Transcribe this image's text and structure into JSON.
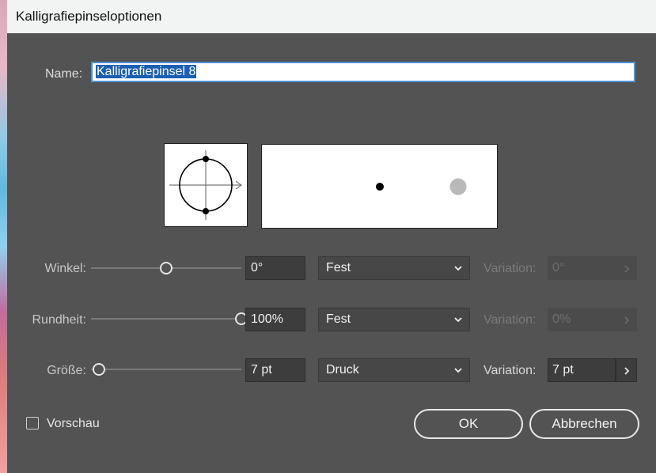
{
  "window": {
    "title": "Kalligrafiepinseloptionen"
  },
  "name": {
    "label": "Name:",
    "value": "Kalligrafiepinsel 8"
  },
  "rows": {
    "winkel": {
      "label": "Winkel:",
      "slider_fraction": 0.5,
      "value": "0°",
      "mode": "Fest",
      "variation_label": "Variation:",
      "variation_value": "0°",
      "variation_enabled": false
    },
    "rundheit": {
      "label": "Rundheit:",
      "slider_fraction": 1.0,
      "value": "100%",
      "mode": "Fest",
      "variation_label": "Variation:",
      "variation_value": "0%",
      "variation_enabled": false
    },
    "groesse": {
      "label": "Größe:",
      "slider_fraction": 0.05,
      "value": "7 pt",
      "mode": "Druck",
      "variation_label": "Variation:",
      "variation_value": "7 pt",
      "variation_enabled": true
    }
  },
  "footer": {
    "preview_label": "Vorschau",
    "preview_checked": false,
    "ok_label": "OK",
    "cancel_label": "Abbrechen"
  },
  "colors": {
    "dialog_bg": "#535353",
    "selection": "#1a5fb4",
    "focus_ring": "#4d8fd6"
  },
  "icons": {
    "dropdown": "chevron-down-icon",
    "variation": "chevron-right-icon"
  }
}
